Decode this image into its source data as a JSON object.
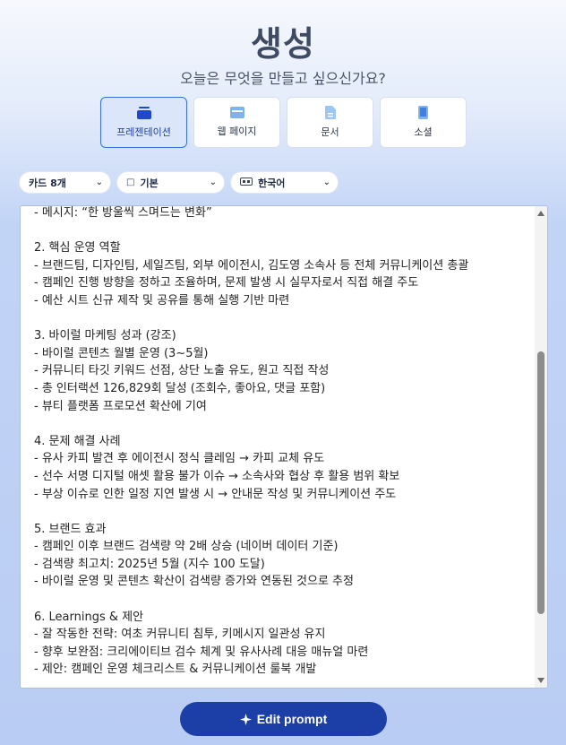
{
  "header": {
    "title": "생성",
    "subtitle": "오늘은 무엇을 만들고 싶으신가요?"
  },
  "types": [
    {
      "label": "프레젠테이션",
      "icon": "presentation-icon",
      "active": true
    },
    {
      "label": "웹 페이지",
      "icon": "webpage-icon",
      "active": false
    },
    {
      "label": "문서",
      "icon": "document-icon",
      "active": false
    },
    {
      "label": "소셜",
      "icon": "social-icon",
      "active": false
    }
  ],
  "controls": {
    "cards": "카드 8개",
    "theme": "기본",
    "language": "한국어"
  },
  "editor": {
    "lines": [
      "- 메시지: “한 방울씩 스며드는 변화”",
      "",
      "2. 핵심 운영 역할",
      "- 브랜드팀, 디자인팀, 세일즈팀, 외부 에이전시, 김도영 소속사 등 전체 커뮤니케이션 총괄",
      "- 캠페인 진행 방향을 정하고 조율하며, 문제 발생 시 실무자로서 직접 해결 주도",
      "- 예산 시트 신규 제작 및 공유를 통해 실행 기반 마련",
      "",
      "3. 바이럴 마케팅 성과 (강조)",
      "- 바이럴 콘텐츠 월별 운영 (3~5월)",
      "- 커뮤니티 타깃 키워드 선점, 상단 노출 유도, 원고 직접 작성",
      "- 총 인터랙션 126,829회 달성 (조회수, 좋아요, 댓글 포함)",
      "- 뷰티 플랫폼 프로모션 확산에 기여",
      "",
      "4. 문제 해결 사례",
      "- 유사 카피 발견 후 에이전시 정식 클레임 → 카피 교체 유도",
      "- 선수 서명 디지털 애셋 활용 불가 이슈 → 소속사와 협상 후 활용 범위 확보",
      "- 부상 이슈로 인한 일정 지연 발생 시 → 안내문 작성 및 커뮤니케이션 주도",
      "",
      "5. 브랜드 효과",
      "- 캠페인 이후 브랜드 검색량 약 2배 상승 (네이버 데이터 기준)",
      "- 검색량 최고치: 2025년 5월 (지수 100 도달)",
      "- 바이럴 운영 및 콘텐츠 확산이 검색량 증가와 연동된 것으로 추정",
      "",
      "6. Learnings & 제안",
      "- 잘 작동한 전략: 여초 커뮤니티 침투, 키메시지 일관성 유지",
      "- 향후 보완점: 크리에이티브 검수 체계 및 유사사례 대응 매뉴얼 마련",
      "- 제안: 캠페인 운영 체크리스트 & 커뮤니케이션 룰북 개발"
    ]
  },
  "footer": {
    "edit_prompt": "Edit prompt"
  }
}
